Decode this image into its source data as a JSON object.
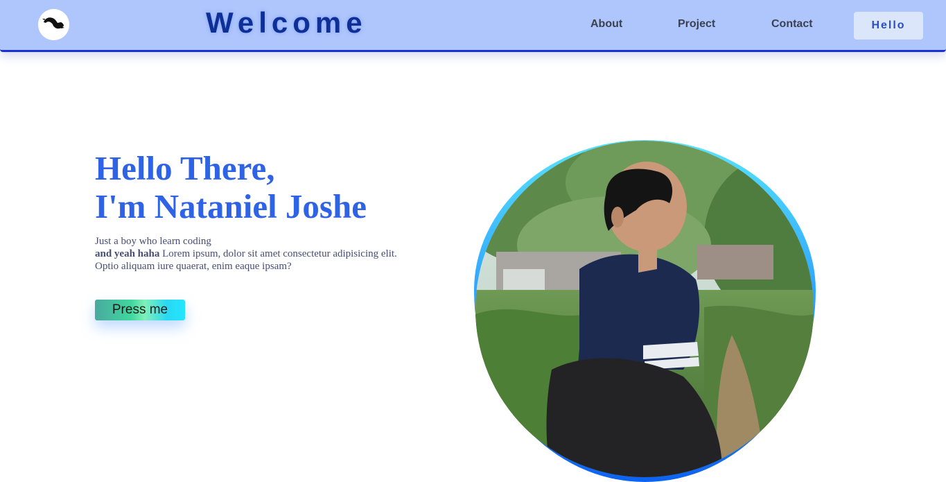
{
  "navbar": {
    "brand": "Welcome",
    "links": [
      {
        "label": "About"
      },
      {
        "label": "Project"
      },
      {
        "label": "Contact"
      }
    ],
    "cta_label": "Hello",
    "logo_icon": "silhouette-logo-icon"
  },
  "hero": {
    "title_line1": "Hello There,",
    "title_line2": "I'm Nataniel Joshe",
    "text_line1": "Just a boy who learn coding",
    "text_bold": "and yeah haha",
    "text_line2_rest": " Lorem ipsum, dolor sit amet consectetur adipisicing elit.",
    "text_line3": "Optio aliquam iure quaerat, enim eaque ipsam?",
    "button_label": "Press me"
  },
  "colors": {
    "navbar_bg": "#aec6fb",
    "navbar_border": "#1a2fd6",
    "brand": "#0d2f96",
    "title": "#2f63e6",
    "frame_gradient": [
      "#57e3ff",
      "#0d63f2"
    ]
  }
}
